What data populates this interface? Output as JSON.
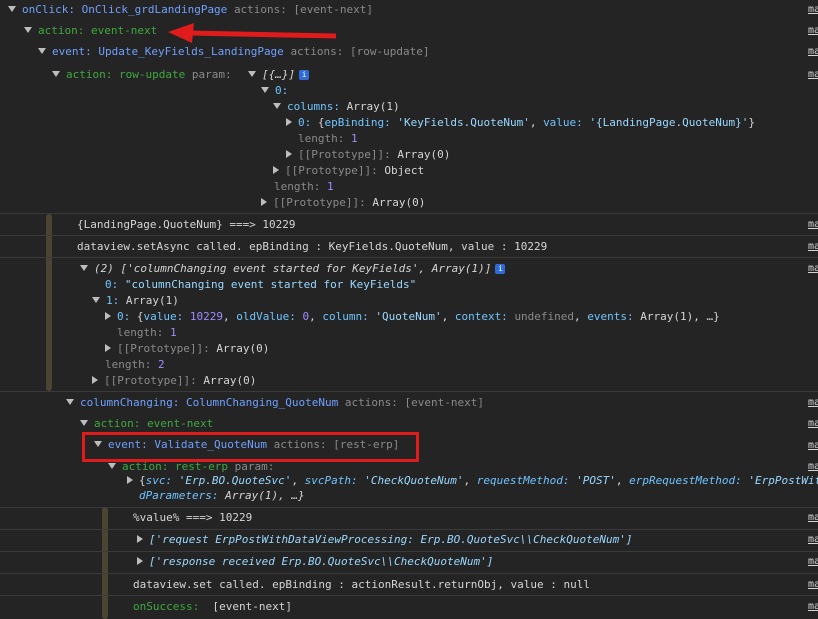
{
  "links": {
    "label": "ma"
  },
  "l1": {
    "prefix": "onClick:",
    "name": "OnClick_grdLandingPage",
    "actions": "actions: [event-next]"
  },
  "l2": {
    "text": "action: event-next"
  },
  "l3": {
    "prefix": "event:",
    "name": "Update_KeyFields_LandingPage",
    "actions": "actions: [row-update]"
  },
  "l4": {
    "action": "action: row-update",
    "param": "param:",
    "value": "[{…}]"
  },
  "l5": {
    "text": "0:"
  },
  "l6": {
    "key": "columns:",
    "value": "Array(1)"
  },
  "l7": {
    "idx": "0:",
    "open": "{",
    "k1": "epBinding:",
    "v1": "'KeyFields.QuoteNum'",
    "k2": "value:",
    "v2": "'{LandingPage.QuoteNum}'",
    "close": "}"
  },
  "l8": {
    "key": "length:",
    "value": "1"
  },
  "l9": {
    "key": "[[Prototype]]:",
    "value": "Array(0)"
  },
  "l10": {
    "key": "[[Prototype]]:",
    "value": "Object"
  },
  "l11": {
    "key": "length:",
    "value": "1"
  },
  "l12": {
    "key": "[[Prototype]]:",
    "value": "Array(0)"
  },
  "l13": {
    "text": "{LandingPage.QuoteNum} ===> 10229"
  },
  "l14": {
    "text": "dataview.setAsync called. epBinding : KeyFields.QuoteNum, value : 10229"
  },
  "l15": {
    "text": "(2) ['columnChanging event started for KeyFields', Array(1)]"
  },
  "l16": {
    "idx": "0:",
    "value": "\"columnChanging event started for KeyFields\""
  },
  "l17": {
    "idx": "1:",
    "value": "Array(1)"
  },
  "l18": {
    "idx": "0:",
    "open": "{",
    "k1": "value:",
    "v1": "10229",
    "k2": "oldValue:",
    "v2": "0",
    "k3": "column:",
    "v3": "'QuoteNum'",
    "k4": "context:",
    "v4": "undefined",
    "k5": "events:",
    "v5": "Array(1), …}"
  },
  "l19": {
    "key": "length:",
    "value": "1"
  },
  "l20": {
    "key": "[[Prototype]]:",
    "value": "Array(0)"
  },
  "l21": {
    "key": "length:",
    "value": "2"
  },
  "l22": {
    "key": "[[Prototype]]:",
    "value": "Array(0)"
  },
  "l23": {
    "prefix": "columnChanging:",
    "name": "ColumnChanging_QuoteNum",
    "actions": "actions: [event-next]"
  },
  "l24": {
    "text": "action: event-next"
  },
  "l25": {
    "prefix": "event:",
    "name": "Validate_QuoteNum",
    "actions": "actions: [rest-erp]"
  },
  "l26": {
    "action": "action: rest-erp",
    "param": "param:"
  },
  "l27": {
    "open": "{",
    "k1": "svc:",
    "v1": "'Erp.BO.QuoteSvc'",
    "k2": "svcPath:",
    "v2": "'CheckQuoteNum'",
    "k3": "requestMethod:",
    "v3": "'POST'",
    "k4": "erpRequestMethod:",
    "v4": "'ErpPostWit"
  },
  "l28": {
    "k1": "dParameters:",
    "v1": "Array(1), …}"
  },
  "l29": {
    "text": "%value% ===> 10229"
  },
  "l30": {
    "text": "['request ErpPostWithDataViewProcessing: Erp.BO.QuoteSvc\\\\CheckQuoteNum']"
  },
  "l31": {
    "text": "['response received Erp.BO.QuoteSvc\\\\CheckQuoteNum']"
  },
  "l32": {
    "text": "dataview.set called. epBinding : actionResult.returnObj, value : null"
  },
  "l33": {
    "label": "onSuccess:",
    "value": "[event-next]"
  }
}
